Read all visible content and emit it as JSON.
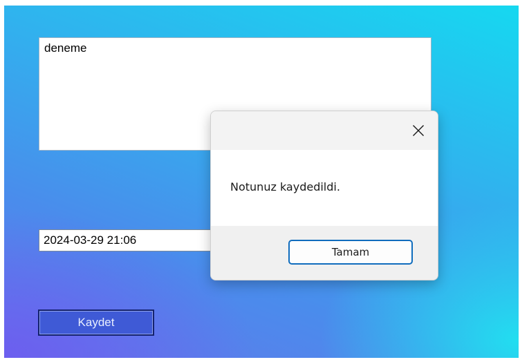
{
  "form": {
    "note_text": "deneme",
    "datetime_value": "2024-03-29 21:06",
    "save_label": "Kaydet"
  },
  "dialog": {
    "message": "Notunuz kaydedildi.",
    "ok_label": "Tamam",
    "close_icon": "close-icon"
  },
  "colors": {
    "background_cyan": "#16d8f0",
    "background_violet": "#6377ea",
    "save_button": "#3f5ad6",
    "ok_button_border": "#0f6cbd"
  }
}
